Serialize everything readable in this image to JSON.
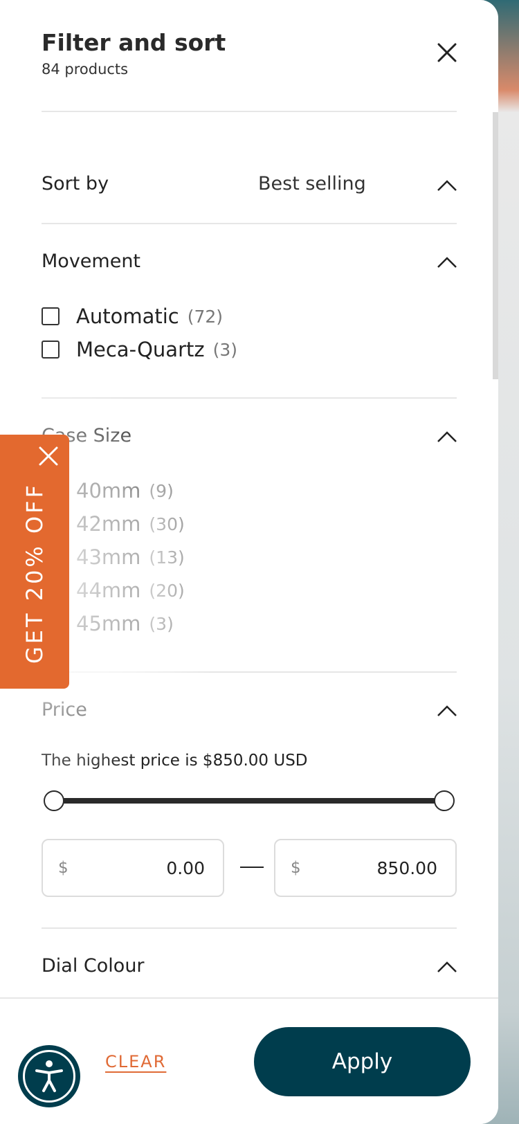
{
  "header": {
    "title": "Filter and sort",
    "subtitle": "84 products"
  },
  "sort": {
    "label": "Sort by",
    "value": "Best selling"
  },
  "movement": {
    "label": "Movement",
    "options": [
      {
        "label": "Automatic",
        "count": "(72)"
      },
      {
        "label": "Meca-Quartz",
        "count": "(3)"
      }
    ]
  },
  "case_size": {
    "label": "Case Size",
    "options": [
      {
        "label": "40mm",
        "count": "(9)"
      },
      {
        "label": "42mm",
        "count": "(30)"
      },
      {
        "label": "43mm",
        "count": "(13)"
      },
      {
        "label": "44mm",
        "count": "(20)"
      },
      {
        "label": "45mm",
        "count": "(3)"
      }
    ]
  },
  "price": {
    "label": "Price",
    "note": "The highest price is $850.00 USD",
    "currency": "$",
    "min": "0.00",
    "max": "850.00",
    "slider_min_fraction": 0,
    "slider_max_fraction": 1
  },
  "dial_colour": {
    "label": "Dial Colour"
  },
  "footer": {
    "clear": "CLEAR",
    "apply": "Apply"
  },
  "promo": {
    "text": "GET 20% OFF"
  },
  "colors": {
    "accent": "#e3692f",
    "primary": "#003d4d"
  }
}
